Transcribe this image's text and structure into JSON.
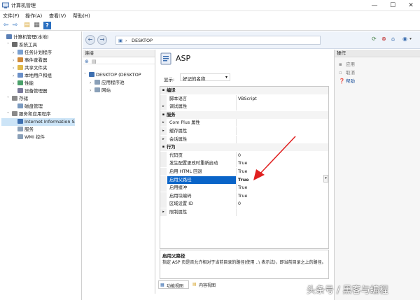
{
  "window": {
    "title": "计算机管理",
    "minimize": "—",
    "maximize": "☐",
    "close": "✕"
  },
  "menu": [
    "文件(F)",
    "操作(A)",
    "查看(V)",
    "帮助(H)"
  ],
  "left_tree": [
    {
      "label": "计算机管理(本地)",
      "indent": 0,
      "chev": "",
      "color": "#5a7fb5"
    },
    {
      "label": "系统工具",
      "indent": 1,
      "chev": "˅",
      "color": "#6b6b6b"
    },
    {
      "label": "任务计划程序",
      "indent": 2,
      "chev": "›",
      "color": "#7aa0d0"
    },
    {
      "label": "事件查看器",
      "indent": 2,
      "chev": "›",
      "color": "#d08a3a"
    },
    {
      "label": "共享文件夹",
      "indent": 2,
      "chev": "›",
      "color": "#e0b94a"
    },
    {
      "label": "本地用户和组",
      "indent": 2,
      "chev": "›",
      "color": "#6a8fc8"
    },
    {
      "label": "性能",
      "indent": 2,
      "chev": "›",
      "color": "#4aa06a"
    },
    {
      "label": "设备管理器",
      "indent": 2,
      "chev": "",
      "color": "#7a7a9a"
    },
    {
      "label": "存储",
      "indent": 1,
      "chev": "˅",
      "color": "#8a8a8a"
    },
    {
      "label": "磁盘管理",
      "indent": 2,
      "chev": "",
      "color": "#7a9ac0"
    },
    {
      "label": "服务和应用程序",
      "indent": 1,
      "chev": "˅",
      "color": "#8a8a8a"
    },
    {
      "label": "Internet Information S",
      "indent": 2,
      "chev": "",
      "color": "#3d6fb0",
      "selected": true
    },
    {
      "label": "服务",
      "indent": 2,
      "chev": "",
      "color": "#8aa0b8"
    },
    {
      "label": "WMI 控件",
      "indent": 2,
      "chev": "",
      "color": "#8aa0b8"
    }
  ],
  "iis": {
    "address": "DESKTOP",
    "connections_header": "连接",
    "conn_tree": [
      {
        "label": "DESKTOP (DESKTOP",
        "indent": 0
      },
      {
        "label": "应用程序池",
        "indent": 1
      },
      {
        "label": "网站",
        "indent": 1
      }
    ],
    "page_title": "ASP",
    "display_label": "显示:",
    "display_value": "好记的名称",
    "grid": [
      {
        "type": "cat",
        "name": "编译"
      },
      {
        "type": "prop",
        "name": "脚本语言",
        "value": "VBScript"
      },
      {
        "type": "sub",
        "name": "调试属性",
        "value": ""
      },
      {
        "type": "cat",
        "name": "服务"
      },
      {
        "type": "sub",
        "name": "Com Plus 属性",
        "value": ""
      },
      {
        "type": "sub",
        "name": "缓存属性",
        "value": ""
      },
      {
        "type": "sub",
        "name": "会话属性",
        "value": ""
      },
      {
        "type": "cat",
        "name": "行为"
      },
      {
        "type": "prop",
        "name": "代码页",
        "value": "0"
      },
      {
        "type": "prop",
        "name": "发生配置更改时重新启动",
        "value": "True"
      },
      {
        "type": "prop",
        "name": "启用 HTML 回退",
        "value": "True"
      },
      {
        "type": "sel",
        "name": "启用父路径",
        "value": "True"
      },
      {
        "type": "prop",
        "name": "启用缓冲",
        "value": "True"
      },
      {
        "type": "prop",
        "name": "启用块编码",
        "value": "True"
      },
      {
        "type": "prop",
        "name": "区域设置 ID",
        "value": "0"
      },
      {
        "type": "sub",
        "name": "限制属性",
        "value": ""
      }
    ],
    "desc_title": "启用父路径",
    "desc_text": "指定 ASP 页是否允许相对于当前目录的路径(使用 ..\\ 表示法)，即当前目录之上的路径。",
    "tab_feature": "功能视图",
    "tab_content": "内容视图",
    "actions_header": "操作",
    "actions": [
      {
        "label": "应用",
        "icon": "apply-icon"
      },
      {
        "label": "取消",
        "icon": "cancel-icon"
      },
      {
        "label": "帮助",
        "icon": "help-icon",
        "active": true
      }
    ]
  },
  "watermark": "头条号 / 黑客与编程",
  "colors": {
    "accent": "#0a64c8",
    "arrow": "#e02020"
  }
}
